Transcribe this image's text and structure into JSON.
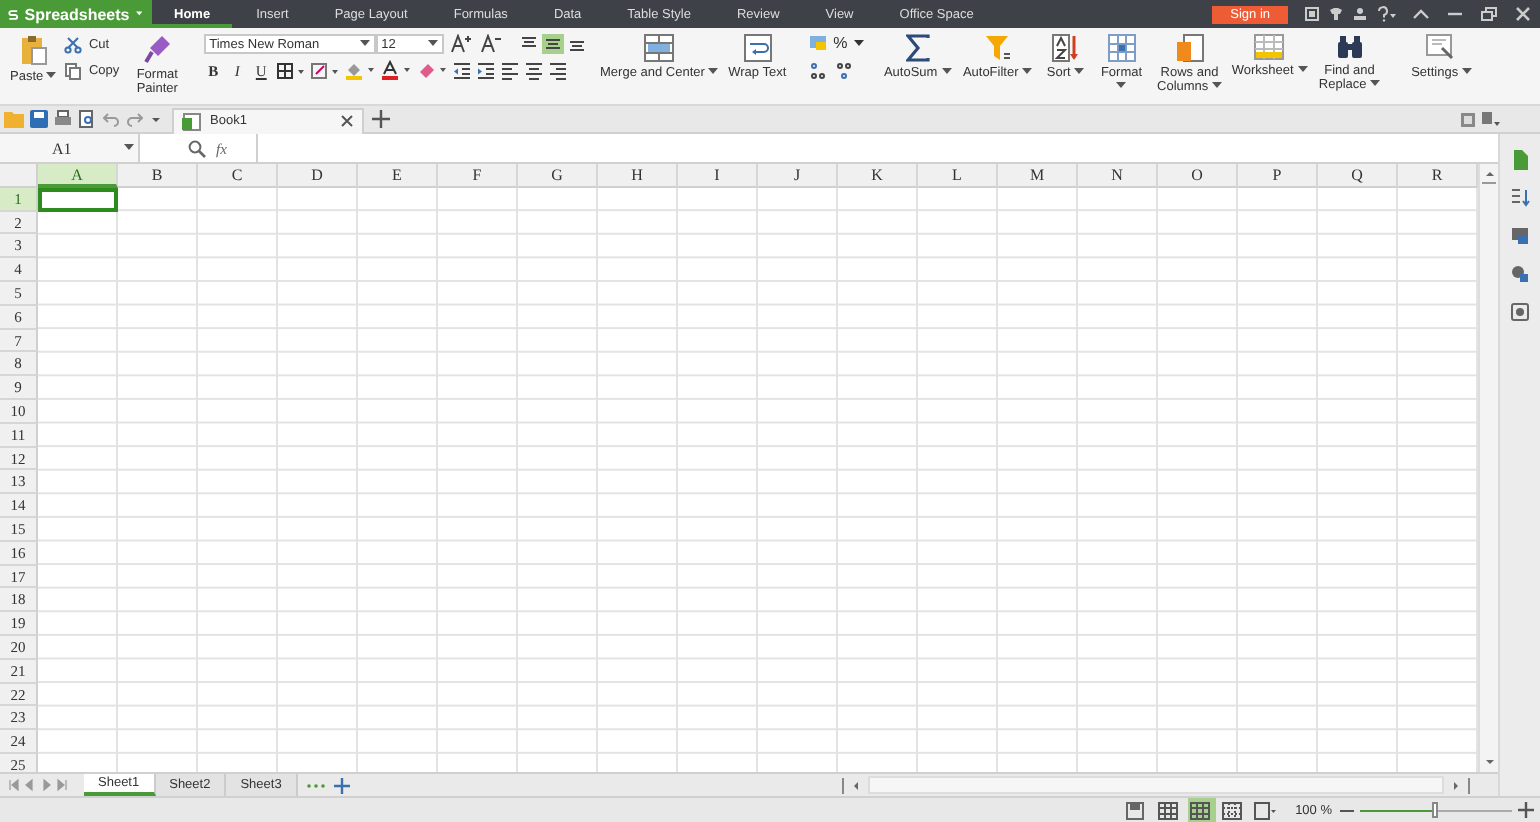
{
  "app": {
    "name": "Spreadsheets"
  },
  "menu_tabs": [
    {
      "label": "Home",
      "selected": true
    },
    {
      "label": "Insert",
      "selected": false
    },
    {
      "label": "Page Layout",
      "selected": false
    },
    {
      "label": "Formulas",
      "selected": false
    },
    {
      "label": "Data",
      "selected": false
    },
    {
      "label": "Table Style",
      "selected": false
    },
    {
      "label": "Review",
      "selected": false
    },
    {
      "label": "View",
      "selected": false
    },
    {
      "label": "Office Space",
      "selected": false
    }
  ],
  "sign_in": "Sign in",
  "ribbon": {
    "paste": "Paste",
    "cut": "Cut",
    "copy": "Copy",
    "format_painter": "Format Painter",
    "font_name": "Times New Roman",
    "font_size": "12",
    "bold": "B",
    "italic": "I",
    "underline": "U",
    "align": [
      {
        "selected": false
      },
      {
        "selected": true
      },
      {
        "selected": false
      }
    ],
    "percent": "%",
    "merge": "Merge and Center",
    "wrap": "Wrap Text",
    "autosum": "AutoSum",
    "autofilter": "AutoFilter",
    "sort": "Sort",
    "format": "Format",
    "rows_columns": "Rows and Columns",
    "worksheet": "Worksheet",
    "find_replace": "Find and Replace",
    "settings": "Settings"
  },
  "document_tab": {
    "title": "Book1"
  },
  "formula_bar": {
    "name_box": "A1",
    "fx": "fx"
  },
  "grid": {
    "columns": [
      {
        "label": "A",
        "selected": true
      },
      {
        "label": "B",
        "selected": false
      },
      {
        "label": "C",
        "selected": false
      },
      {
        "label": "D",
        "selected": false
      },
      {
        "label": "E",
        "selected": false
      },
      {
        "label": "F",
        "selected": false
      },
      {
        "label": "G",
        "selected": false
      },
      {
        "label": "H",
        "selected": false
      },
      {
        "label": "I",
        "selected": false
      },
      {
        "label": "J",
        "selected": false
      },
      {
        "label": "K",
        "selected": false
      },
      {
        "label": "L",
        "selected": false
      },
      {
        "label": "M",
        "selected": false
      },
      {
        "label": "N",
        "selected": false
      },
      {
        "label": "O",
        "selected": false
      },
      {
        "label": "P",
        "selected": false
      },
      {
        "label": "Q",
        "selected": false
      },
      {
        "label": "R",
        "selected": false
      }
    ],
    "rows": [
      {
        "label": "1",
        "selected": true
      },
      {
        "label": "2",
        "selected": false
      },
      {
        "label": "3",
        "selected": false
      },
      {
        "label": "4",
        "selected": false
      },
      {
        "label": "5",
        "selected": false
      },
      {
        "label": "6",
        "selected": false
      },
      {
        "label": "7",
        "selected": false
      },
      {
        "label": "8",
        "selected": false
      },
      {
        "label": "9",
        "selected": false
      },
      {
        "label": "10",
        "selected": false
      },
      {
        "label": "11",
        "selected": false
      },
      {
        "label": "12",
        "selected": false
      },
      {
        "label": "13",
        "selected": false
      },
      {
        "label": "14",
        "selected": false
      },
      {
        "label": "15",
        "selected": false
      },
      {
        "label": "16",
        "selected": false
      },
      {
        "label": "17",
        "selected": false
      },
      {
        "label": "18",
        "selected": false
      },
      {
        "label": "19",
        "selected": false
      },
      {
        "label": "20",
        "selected": false
      },
      {
        "label": "21",
        "selected": false
      },
      {
        "label": "22",
        "selected": false
      },
      {
        "label": "23",
        "selected": false
      },
      {
        "label": "24",
        "selected": false
      },
      {
        "label": "25",
        "selected": false
      }
    ]
  },
  "sheets": [
    {
      "label": "Sheet1",
      "selected": true
    },
    {
      "label": "Sheet2",
      "selected": false
    },
    {
      "label": "Sheet3",
      "selected": false
    }
  ],
  "status_bar": {
    "views": [
      {
        "selected": false
      },
      {
        "selected": true
      },
      {
        "selected": false
      },
      {
        "selected": false
      }
    ],
    "zoom": "100 %",
    "zoom_slider": {
      "level": 0.5
    }
  }
}
